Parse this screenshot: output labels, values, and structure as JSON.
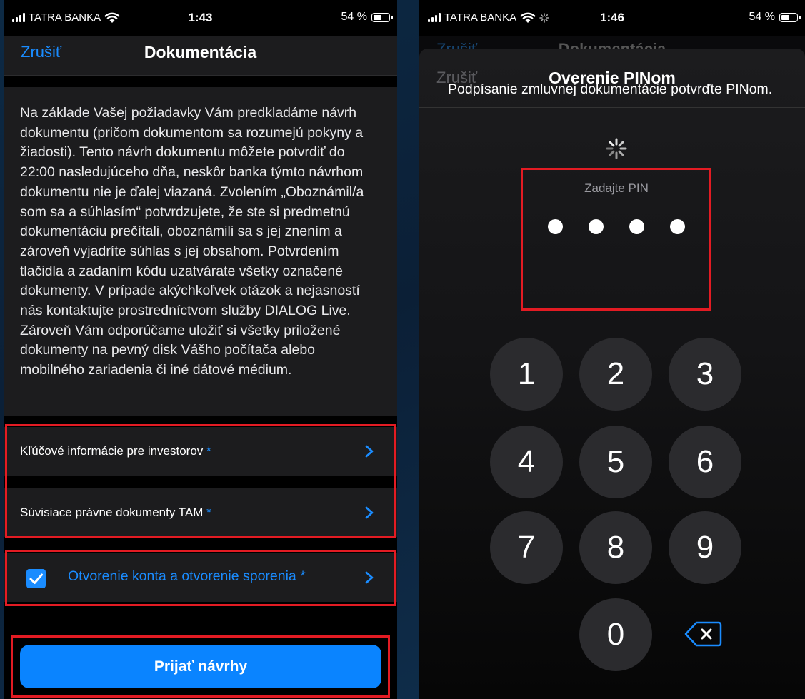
{
  "colors": {
    "accent": "#0a84ff",
    "highlight": "#e31b23",
    "card": "#1c1c1e"
  },
  "left": {
    "status": {
      "carrier": "TATRA BANKA",
      "time": "1:43",
      "battery": "54 %"
    },
    "nav": {
      "cancel": "Zrušiť",
      "title": "Dokumentácia"
    },
    "body_text": "Na základe Vašej požiadavky Vám predkladáme návrh dokumentu (pričom dokumentom sa rozumejú pokyny a žiadosti). Tento návrh dokumentu môžete potvrdiť do 22:00 nasledujúceho dňa, neskôr banka týmto návrhom dokumentu nie je ďalej viazaná. Zvolením „Oboznámil/a som sa a súhlasím“ potvrdzujete, že ste si predmetnú dokumentáciu prečítali, oboznámili sa s jej znením a zároveň vyjadríte súhlas s jej obsahom. Potvrdením tlačidla a zadaním kódu uzatvárate všetky označené dokumenty. V prípade akýchkoľvek otázok a nejasností nás kontaktujte prostredníctvom služby DIALOG Live. Zároveň Vám odporúčame uložiť si všetky priložené dokumenty na pevný disk Vášho počítača alebo mobilného zariadenia či iné dátové médium.",
    "rows": [
      {
        "label": "Kľúčové informácie pre investorov",
        "required": "*"
      },
      {
        "label": "Súvisiace právne dokumenty TAM",
        "required": "*"
      },
      {
        "label": "Otvorenie konta a otvorenie sporenia",
        "required": "*",
        "checked": true
      }
    ],
    "button": "Prijať návrhy"
  },
  "right": {
    "status": {
      "carrier": "TATRA BANKA",
      "time": "1:46",
      "battery": "54 %"
    },
    "background_nav": {
      "cancel": "Zrušiť",
      "title": "Dokumentácia"
    },
    "sheet": {
      "cancel": "Zrušiť",
      "title": "Overenie PINom",
      "prompt": "Podpísanie zmluvnej dokumentácie potvrďte PINom.",
      "pin_label": "Zadajte PIN",
      "pin_digits_entered": 4
    },
    "keypad": [
      "1",
      "2",
      "3",
      "4",
      "5",
      "6",
      "7",
      "8",
      "9",
      "0"
    ],
    "delete_icon": "backspace-icon"
  }
}
